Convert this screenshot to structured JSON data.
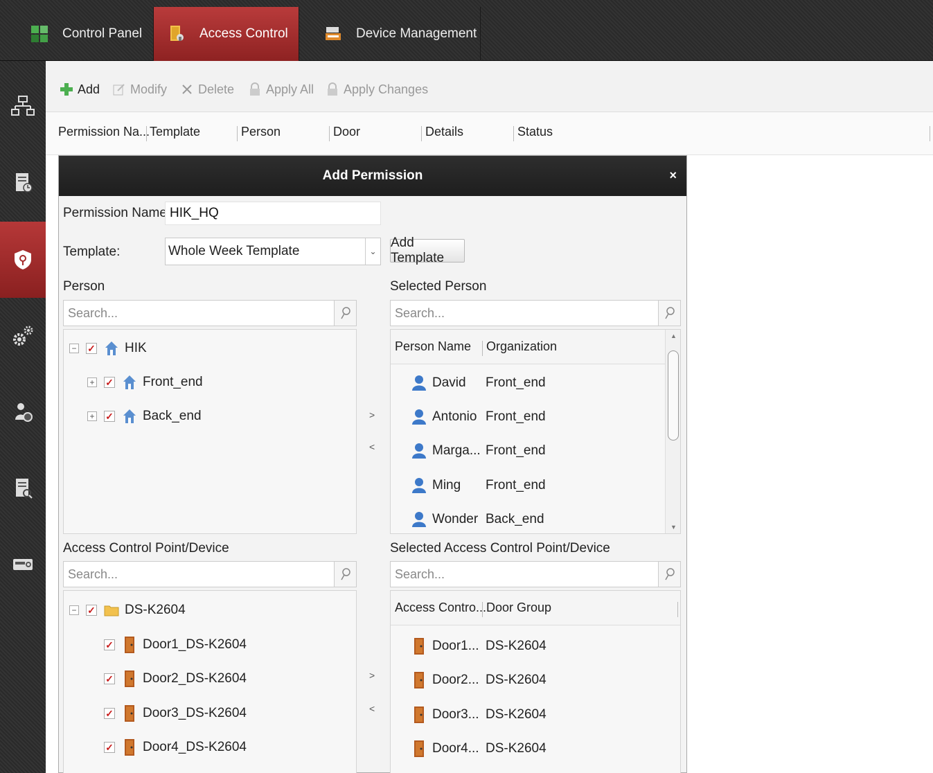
{
  "tabs": [
    {
      "label": "Control Panel",
      "icon": "control-panel-icon"
    },
    {
      "label": "Access Control",
      "icon": "access-control-icon",
      "active": true
    },
    {
      "label": "Device Management",
      "icon": "device-management-icon"
    }
  ],
  "sidebar": {
    "items": [
      {
        "name": "organization-icon"
      },
      {
        "name": "clipboard-schedule-icon"
      },
      {
        "name": "shield-permission-icon",
        "active": true
      },
      {
        "name": "advanced-settings-icon"
      },
      {
        "name": "person-guard-icon"
      },
      {
        "name": "report-search-icon"
      },
      {
        "name": "device-keypad-icon"
      }
    ]
  },
  "toolbar": {
    "add": "Add",
    "modify": "Modify",
    "delete": "Delete",
    "apply_all": "Apply All",
    "apply_changes": "Apply Changes"
  },
  "grid": {
    "columns": [
      "Permission Na...",
      "Template",
      "Person",
      "Door",
      "Details",
      "Status"
    ]
  },
  "dialog": {
    "title": "Add Permission",
    "close": "×",
    "permission_name_label": "Permission Name:",
    "permission_name_value": "HIK_HQ",
    "template_label": "Template:",
    "template_value": "Whole Week Template",
    "add_template": "Add Template",
    "person_label": "Person",
    "selected_person_label": "Selected Person",
    "search_placeholder": "Search...",
    "person_tree": {
      "root": "HIK",
      "children": [
        "Front_end",
        "Back_end"
      ]
    },
    "selected_person_columns": [
      "Person Name",
      "Organization"
    ],
    "selected_persons": [
      {
        "name": "David",
        "org": "Front_end"
      },
      {
        "name": "Antonio",
        "org": "Front_end"
      },
      {
        "name": "Marga...",
        "org": "Front_end"
      },
      {
        "name": "Ming",
        "org": "Front_end"
      },
      {
        "name": "Wonder",
        "org": "Back_end"
      }
    ],
    "move_right": ">",
    "move_left": "<",
    "acp_label": "Access Control Point/Device",
    "selected_acp_label": "Selected Access Control Point/Device",
    "device_tree": {
      "root": "DS-K2604",
      "children": [
        "Door1_DS-K2604",
        "Door2_DS-K2604",
        "Door3_DS-K2604",
        "Door4_DS-K2604"
      ]
    },
    "selected_acp_columns": [
      "Access Contro...",
      "Door Group"
    ],
    "selected_doors": [
      {
        "name": "Door1...",
        "group": "DS-K2604"
      },
      {
        "name": "Door2...",
        "group": "DS-K2604"
      },
      {
        "name": "Door3...",
        "group": "DS-K2604"
      },
      {
        "name": "Door4...",
        "group": "DS-K2604"
      }
    ]
  },
  "colors": {
    "accent_red": "#a52a2a",
    "check_red": "#c81d1d",
    "folder_yellow": "#f2c14e",
    "door_brown": "#b35a1f",
    "person_blue": "#3d79c9"
  }
}
